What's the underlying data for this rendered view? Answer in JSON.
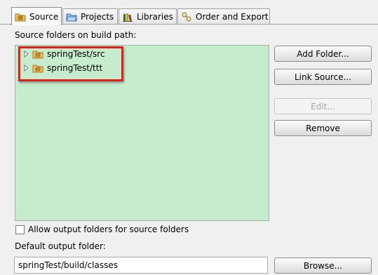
{
  "tabs": [
    {
      "label": "Source",
      "icon": "source-folder-icon",
      "active": true
    },
    {
      "label": "Projects",
      "icon": "projects-folder-icon",
      "active": false
    },
    {
      "label": "Libraries",
      "icon": "libraries-icon",
      "active": false
    },
    {
      "label": "Order and Export",
      "icon": "order-export-icon",
      "active": false
    }
  ],
  "source_folders_label": "Source folders on build path:",
  "tree_items": [
    {
      "label": "springTest/src",
      "icon": "package-folder-icon"
    },
    {
      "label": "springTest/ttt",
      "icon": "package-folder-icon"
    }
  ],
  "buttons": {
    "add_folder": "Add Folder...",
    "link_source": "Link Source...",
    "edit": "Edit...",
    "remove": "Remove",
    "browse": "Browse..."
  },
  "allow_output_label": "Allow output folders for source folders",
  "allow_output_checked": false,
  "default_output_label": "Default output folder:",
  "default_output_value": "springTest/build/classes",
  "colors": {
    "tree_background": "#c6ebcd",
    "highlight_border": "#e0201c"
  }
}
